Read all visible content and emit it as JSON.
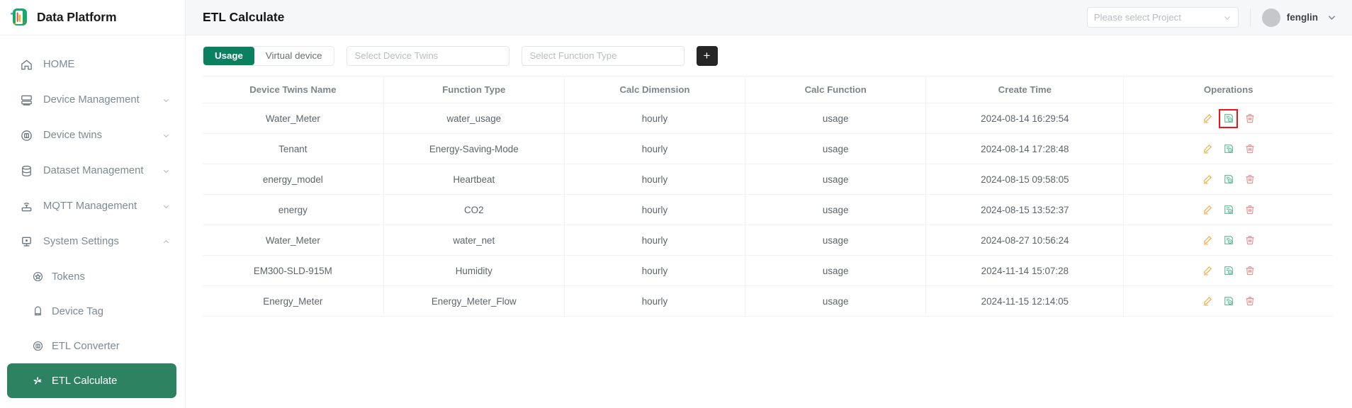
{
  "brand": {
    "title": "Data Platform",
    "logo_icon": "data-platform-logo-icon"
  },
  "sidebar": {
    "items": [
      {
        "label": "HOME",
        "icon": "home-icon",
        "caret": ""
      },
      {
        "label": "Device Management",
        "icon": "server-icon",
        "caret": "chevron-down-icon"
      },
      {
        "label": "Device twins",
        "icon": "twins-circle-icon",
        "caret": "chevron-down-icon"
      },
      {
        "label": "Dataset Management",
        "icon": "database-icon",
        "caret": "chevron-down-icon"
      },
      {
        "label": "MQTT Management",
        "icon": "router-icon",
        "caret": "chevron-down-icon"
      },
      {
        "label": "System Settings",
        "icon": "monitor-icon",
        "caret": "chevron-up-icon"
      }
    ],
    "sub_items": [
      {
        "label": "Tokens",
        "icon": "star-badge-icon",
        "active": false
      },
      {
        "label": "Device Tag",
        "icon": "tag-icon",
        "active": false
      },
      {
        "label": "ETL Converter",
        "icon": "converter-circle-icon",
        "active": false
      },
      {
        "label": "ETL Calculate",
        "icon": "calculate-fan-icon",
        "active": true
      }
    ]
  },
  "header": {
    "page_title": "ETL Calculate",
    "project_placeholder": "Please select Project",
    "project_caret_icon": "chevron-down-icon",
    "user_name": "fenglin",
    "avatar_icon": "avatar",
    "user_caret_icon": "chevron-down-icon"
  },
  "toolbar": {
    "segments": [
      {
        "label": "Usage",
        "active": true
      },
      {
        "label": "Virtual device",
        "active": false
      }
    ],
    "device_twins_placeholder": "Select Device Twins",
    "function_type_placeholder": "Select Function Type",
    "add_label": "+",
    "add_icon": "plus-icon"
  },
  "table": {
    "columns": [
      "Device Twins Name",
      "Function Type",
      "Calc Dimension",
      "Calc Function",
      "Create Time",
      "Operations"
    ],
    "rows": [
      {
        "device_twins_name": "Water_Meter",
        "function_type": "water_usage",
        "calc_dimension": "hourly",
        "calc_function": "usage",
        "create_time": "2024-08-14 16:29:54",
        "highlighted_op": "view"
      },
      {
        "device_twins_name": "Tenant",
        "function_type": "Energy-Saving-Mode",
        "calc_dimension": "hourly",
        "calc_function": "usage",
        "create_time": "2024-08-14 17:28:48",
        "highlighted_op": ""
      },
      {
        "device_twins_name": "energy_model",
        "function_type": "Heartbeat",
        "calc_dimension": "hourly",
        "calc_function": "usage",
        "create_time": "2024-08-15 09:58:05",
        "highlighted_op": ""
      },
      {
        "device_twins_name": "energy",
        "function_type": "CO2",
        "calc_dimension": "hourly",
        "calc_function": "usage",
        "create_time": "2024-08-15 13:52:37",
        "highlighted_op": ""
      },
      {
        "device_twins_name": "Water_Meter",
        "function_type": "water_net",
        "calc_dimension": "hourly",
        "calc_function": "usage",
        "create_time": "2024-08-27 10:56:24",
        "highlighted_op": ""
      },
      {
        "device_twins_name": "EM300-SLD-915M",
        "function_type": "Humidity",
        "calc_dimension": "hourly",
        "calc_function": "usage",
        "create_time": "2024-11-14 15:07:28",
        "highlighted_op": ""
      },
      {
        "device_twins_name": "Energy_Meter",
        "function_type": "Energy_Meter_Flow",
        "calc_dimension": "hourly",
        "calc_function": "usage",
        "create_time": "2024-11-15 12:14:05",
        "highlighted_op": ""
      }
    ],
    "operation_icons": {
      "edit": "edit-pencil-icon",
      "view": "view-document-icon",
      "delete": "delete-trash-icon"
    }
  },
  "colors": {
    "accent_green": "#0a8060",
    "sidebar_active_green": "#2d8361",
    "op_edit": "#f0ab3e",
    "op_view": "#5bb894",
    "op_delete": "#f08b8b",
    "highlight_outline": "#f31414",
    "add_button_bg": "#262626"
  }
}
